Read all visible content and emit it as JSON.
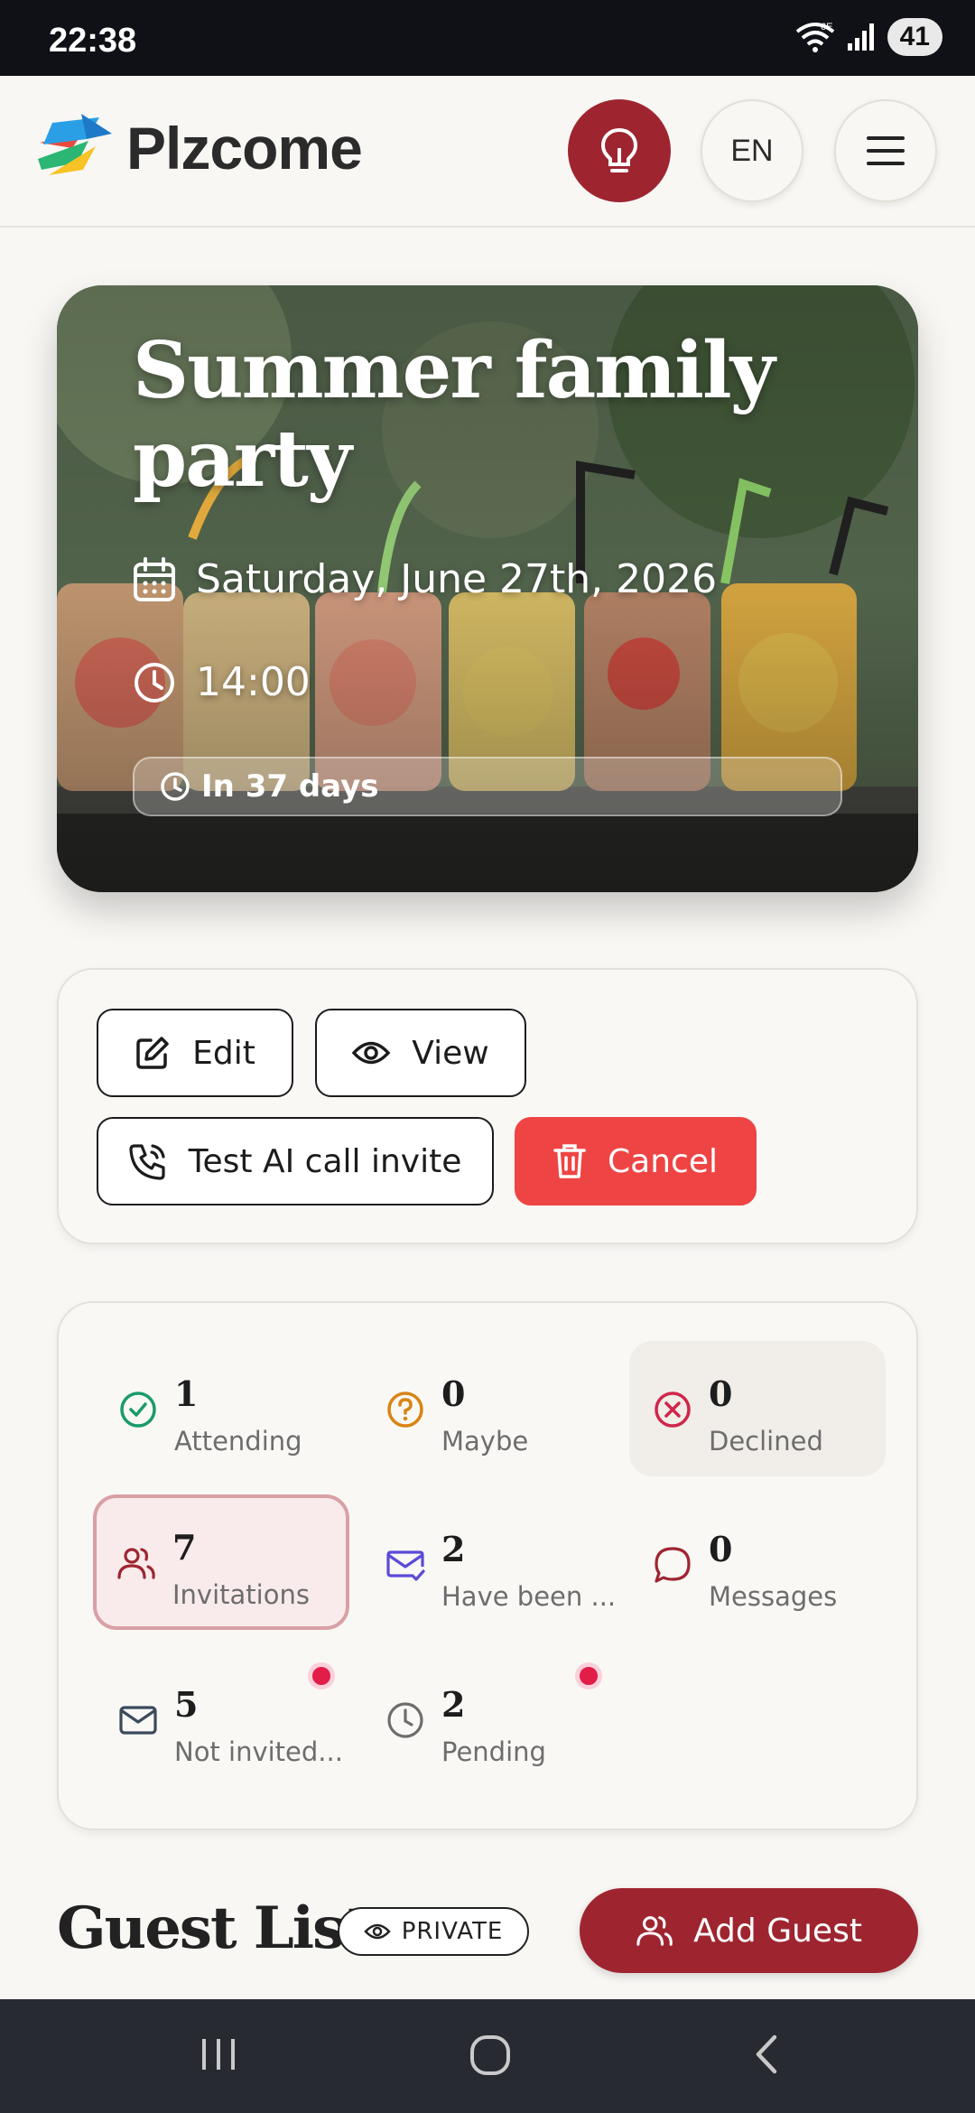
{
  "status_bar": {
    "time": "22:38",
    "battery": "41",
    "network": "6E"
  },
  "header": {
    "logo_text": "Plzcome",
    "language": "EN"
  },
  "event": {
    "title": "Summer family party",
    "date": "Saturday, June 27th, 2026",
    "time": "14:00",
    "countdown": "In 37 days"
  },
  "actions": {
    "edit": "Edit",
    "view": "View",
    "test_call": "Test AI call invite",
    "cancel": "Cancel"
  },
  "stats": {
    "attending": {
      "value": "1",
      "label": "Attending"
    },
    "maybe": {
      "value": "0",
      "label": "Maybe"
    },
    "declined": {
      "value": "0",
      "label": "Declined"
    },
    "invitations": {
      "value": "7",
      "label": "Invitations"
    },
    "have_been": {
      "value": "2",
      "label": "Have been ..."
    },
    "messages": {
      "value": "0",
      "label": "Messages"
    },
    "not_invited": {
      "value": "5",
      "label": "Not invited..."
    },
    "pending": {
      "value": "2",
      "label": "Pending"
    }
  },
  "guest_list": {
    "title": "Guest List",
    "privacy": "PRIVATE",
    "add_button": "Add Guest"
  },
  "colors": {
    "brand": "#9e2530",
    "danger": "#ef4444",
    "notify": "#e11d48"
  }
}
